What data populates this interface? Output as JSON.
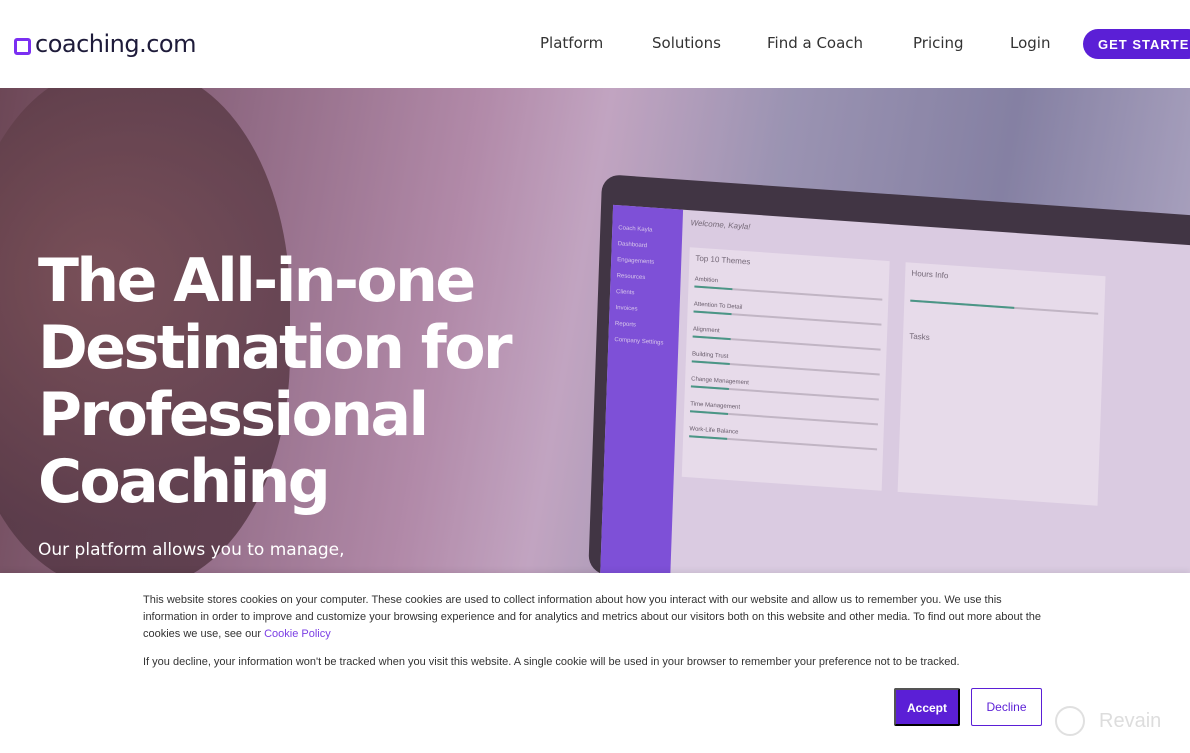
{
  "nav": {
    "logo": "coaching.com",
    "items": [
      "Platform",
      "Solutions",
      "Find a Coach",
      "Pricing",
      "Login"
    ],
    "cta": "GET STARTED"
  },
  "hero": {
    "title_lines": [
      "The All-in-one",
      "Destination for",
      "Professional",
      "Coaching"
    ],
    "subtitle": "Our platform allows you to manage,",
    "mockup": {
      "app_user": "Coach Kayla",
      "welcome": "Welcome, Kayla!",
      "sidebar": [
        "Dashboard",
        "Engagements",
        "Resources",
        "Clients",
        "Invoices",
        "Reports",
        "Company Settings"
      ],
      "top_themes_title": "Top 10 Themes",
      "themes": [
        "Ambition",
        "Attention To Detail",
        "Alignment",
        "Building Trust",
        "Change Management",
        "Time Management",
        "Work-Life Balance"
      ],
      "hours_title": "Hours Info",
      "tasks_title": "Tasks"
    }
  },
  "cookie": {
    "text1": "This website stores cookies on your computer. These cookies are used to collect information about how you interact with our website and allow us to remember you. We use this information in order to improve and customize your browsing experience and for analytics and metrics about our visitors both on this website and other media. To find out more about the cookies we use, see our",
    "policy_link": "Cookie Policy",
    "text2": "If you decline, your information won't be tracked when you visit this website. A single cookie will be used in your browser to remember your preference not to be tracked.",
    "accept": "Accept",
    "decline": "Decline"
  },
  "watermark": "Revain",
  "colors": {
    "brand": "#5b1fd6"
  }
}
